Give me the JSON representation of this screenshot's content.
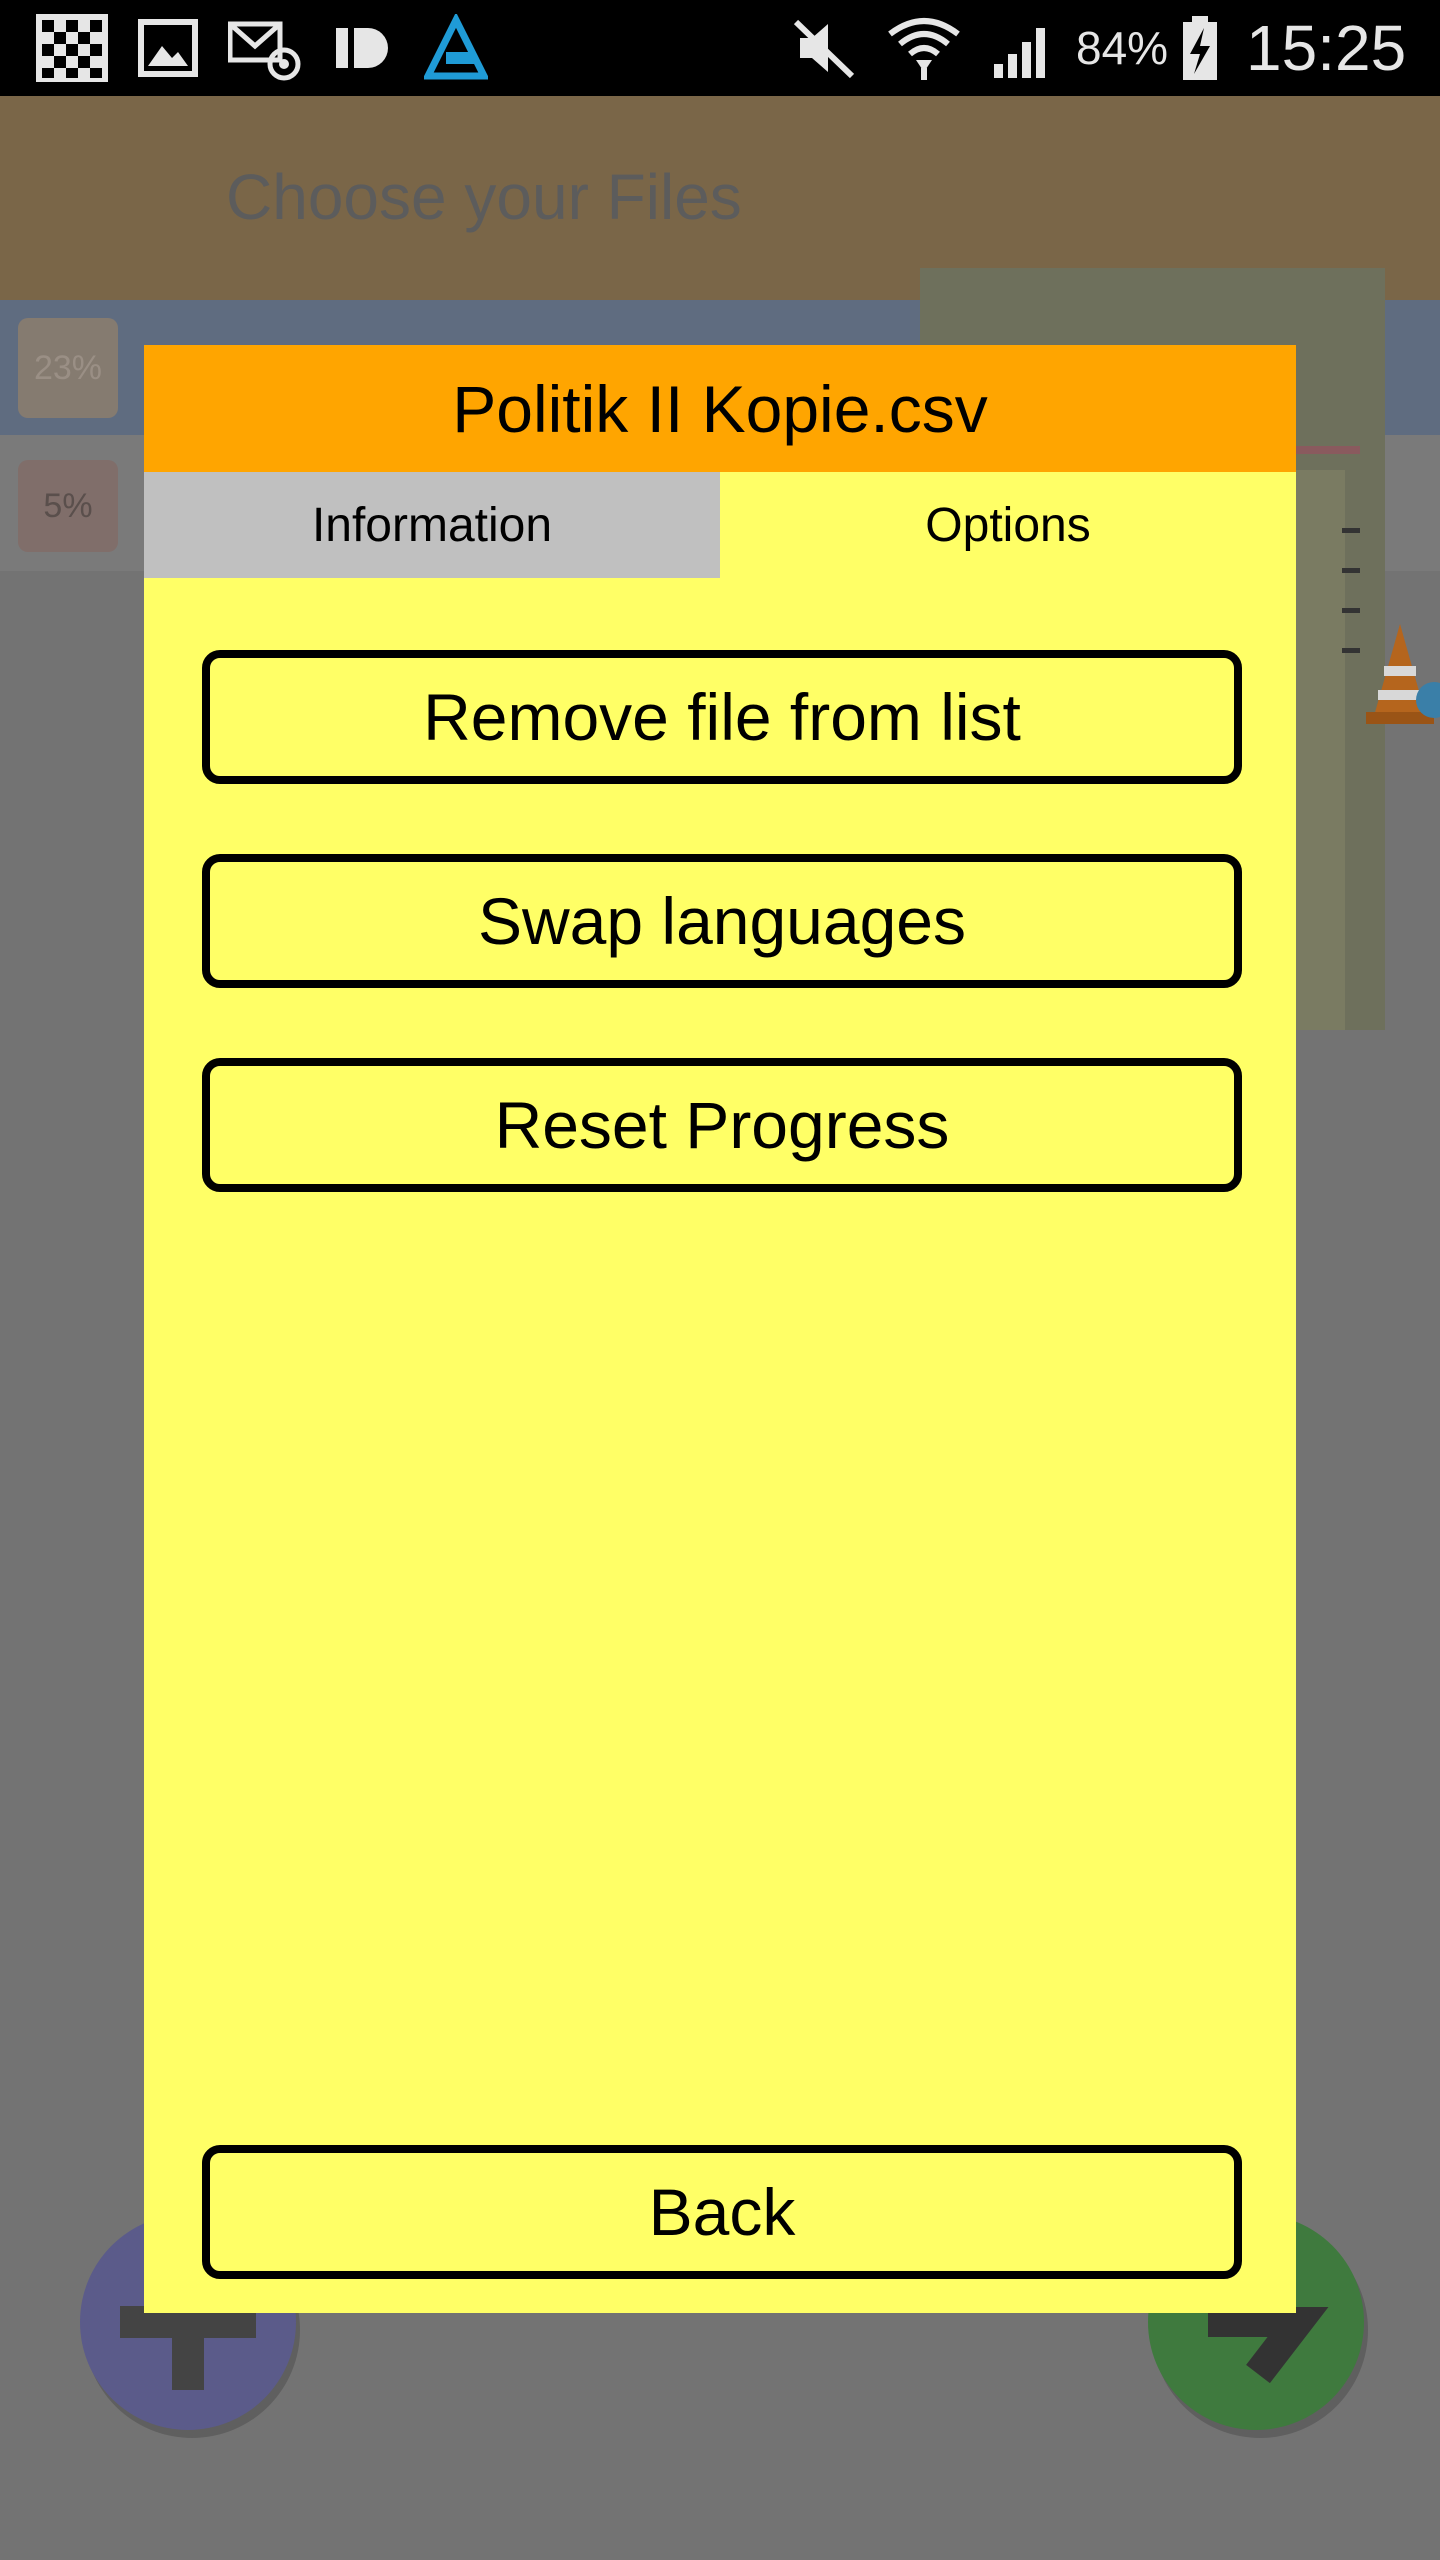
{
  "status_bar": {
    "battery_percent": "84%",
    "time": "15:25",
    "icons": [
      "qr-code-icon",
      "image-icon",
      "email-icon",
      "id-app-icon",
      "beta-app-icon",
      "mute-icon",
      "wifi-icon",
      "signal-icon",
      "battery-charging-icon"
    ]
  },
  "background_app": {
    "title": "Choose your Files",
    "file_rows": [
      {
        "progress_label": "23%"
      },
      {
        "progress_label": "5%"
      }
    ]
  },
  "dialog": {
    "title": "Politik II Kopie.csv",
    "tabs": [
      {
        "label": "Information",
        "selected": false
      },
      {
        "label": "Options",
        "selected": true
      }
    ],
    "buttons": {
      "remove": "Remove file from list",
      "swap": "Swap languages",
      "reset": "Reset Progress",
      "back": "Back"
    }
  },
  "colors": {
    "header": "#ffa500",
    "dialog_bg": "#ffff66",
    "tab_inactive": "#c0c0c0",
    "overlay": "#737373"
  }
}
